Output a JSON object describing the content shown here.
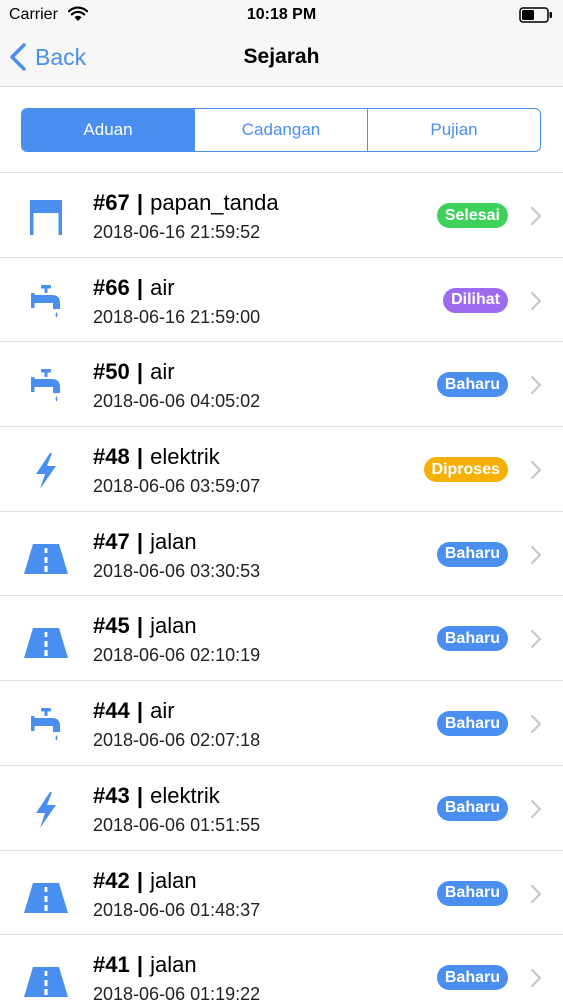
{
  "status_bar": {
    "carrier": "Carrier",
    "time": "10:18 PM"
  },
  "nav": {
    "back_label": "Back",
    "title": "Sejarah"
  },
  "tabs": [
    {
      "label": "Aduan",
      "active": true
    },
    {
      "label": "Cadangan",
      "active": false
    },
    {
      "label": "Pujian",
      "active": false
    }
  ],
  "colors": {
    "accent": "#4a8ef0",
    "selesai": "#3ed15c",
    "dilihat": "#9b6cf0",
    "baharu": "#4a8ef0",
    "diproses": "#f5b10a"
  },
  "items": [
    {
      "id": "#67",
      "sep": "|",
      "category": "papan_tanda",
      "date": "2018-06-16 21:59:52",
      "status": "Selesai",
      "status_key": "selesai",
      "icon": "signboard-icon"
    },
    {
      "id": "#66",
      "sep": "|",
      "category": "air",
      "date": "2018-06-16 21:59:00",
      "status": "Dilihat",
      "status_key": "dilihat",
      "icon": "water-tap-icon"
    },
    {
      "id": "#50",
      "sep": "|",
      "category": "air",
      "date": "2018-06-06 04:05:02",
      "status": "Baharu",
      "status_key": "baharu",
      "icon": "water-tap-icon"
    },
    {
      "id": "#48",
      "sep": "|",
      "category": "elektrik",
      "date": "2018-06-06 03:59:07",
      "status": "Diproses",
      "status_key": "diproses",
      "icon": "lightning-icon"
    },
    {
      "id": "#47",
      "sep": "|",
      "category": "jalan",
      "date": "2018-06-06 03:30:53",
      "status": "Baharu",
      "status_key": "baharu",
      "icon": "road-icon"
    },
    {
      "id": "#45",
      "sep": "|",
      "category": "jalan",
      "date": "2018-06-06 02:10:19",
      "status": "Baharu",
      "status_key": "baharu",
      "icon": "road-icon"
    },
    {
      "id": "#44",
      "sep": "|",
      "category": "air",
      "date": "2018-06-06 02:07:18",
      "status": "Baharu",
      "status_key": "baharu",
      "icon": "water-tap-icon"
    },
    {
      "id": "#43",
      "sep": "|",
      "category": "elektrik",
      "date": "2018-06-06 01:51:55",
      "status": "Baharu",
      "status_key": "baharu",
      "icon": "lightning-icon"
    },
    {
      "id": "#42",
      "sep": "|",
      "category": "jalan",
      "date": "2018-06-06 01:48:37",
      "status": "Baharu",
      "status_key": "baharu",
      "icon": "road-icon"
    },
    {
      "id": "#41",
      "sep": "|",
      "category": "jalan",
      "date": "2018-06-06 01:19:22",
      "status": "Baharu",
      "status_key": "baharu",
      "icon": "road-icon"
    }
  ]
}
